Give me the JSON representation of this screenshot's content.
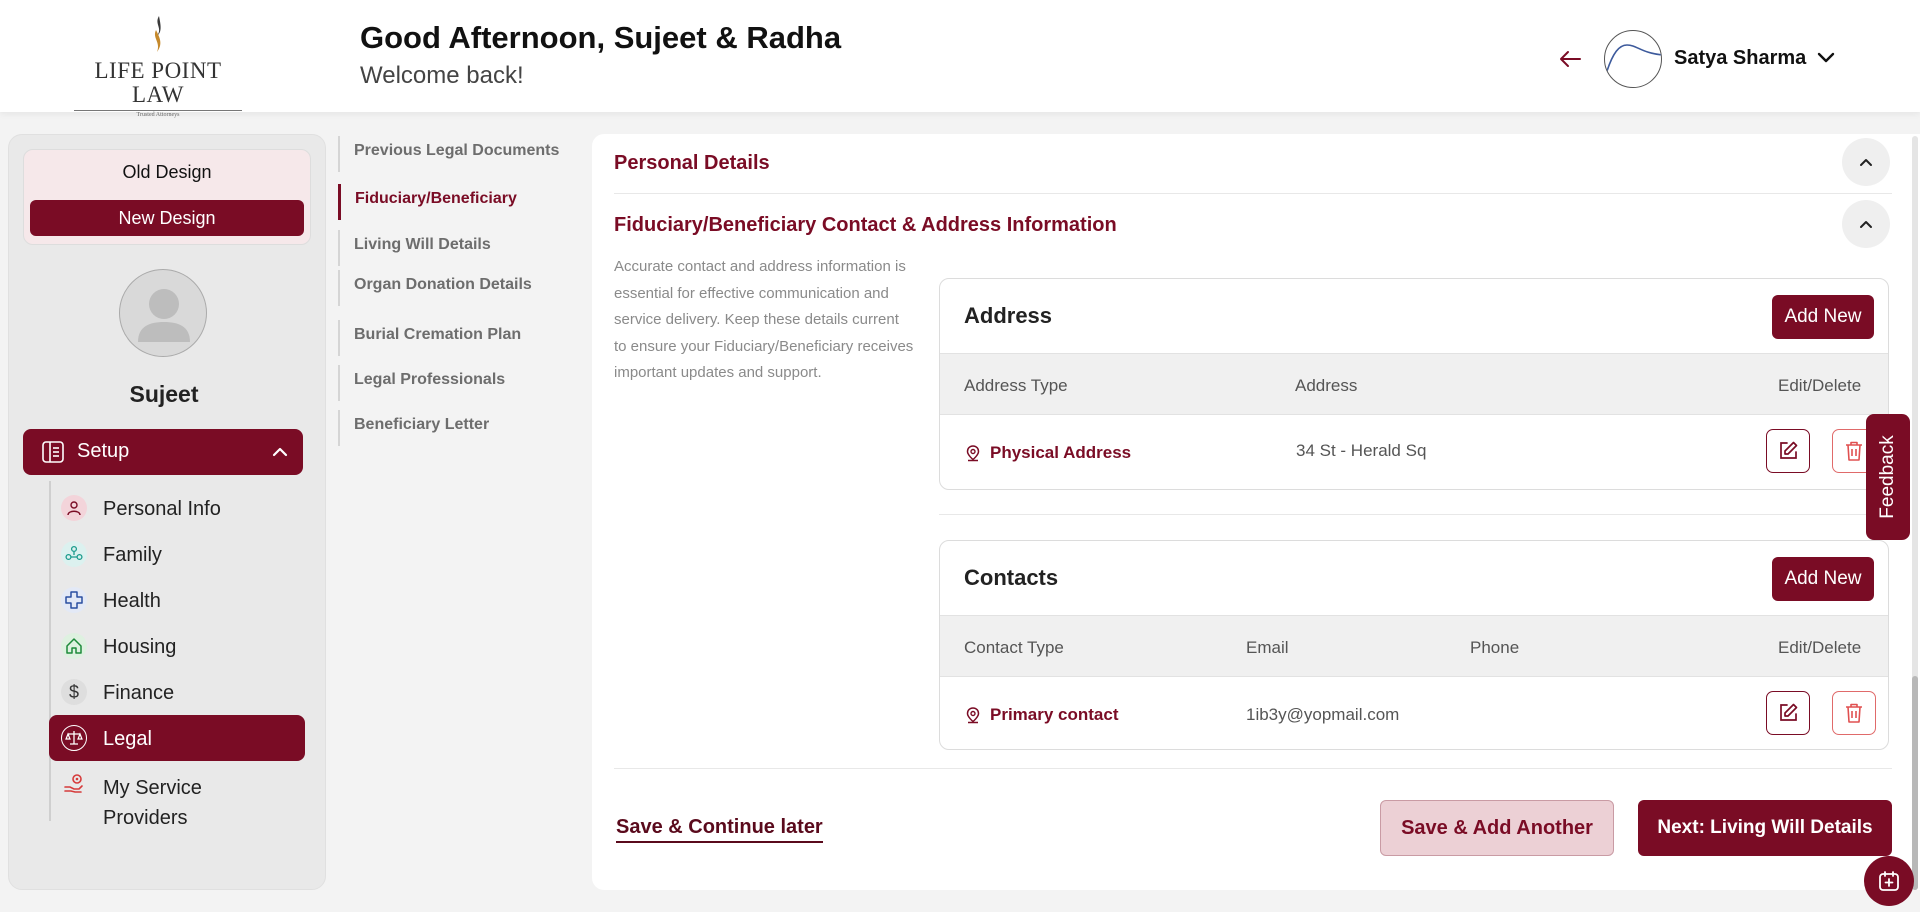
{
  "brand": {
    "logo_text": "LIFE POINT LAW",
    "logo_tagline": "Trusted Attorneys"
  },
  "header": {
    "greeting": "Good Afternoon, Sujeet & Radha",
    "welcome": "Welcome back!",
    "user_name": "Satya Sharma"
  },
  "sidebar": {
    "old_design": "Old Design",
    "new_design": "New Design",
    "profile_name": "Sujeet",
    "setup_label": "Setup",
    "items": [
      {
        "label": "Personal Info",
        "icon": "person-icon"
      },
      {
        "label": "Family",
        "icon": "family-icon"
      },
      {
        "label": "Health",
        "icon": "health-cross-icon"
      },
      {
        "label": "Housing",
        "icon": "house-icon"
      },
      {
        "label": "Finance",
        "icon": "dollar-icon"
      },
      {
        "label": "Legal",
        "icon": "scales-icon"
      },
      {
        "label": "My Service Providers",
        "icon": "hand-gear-icon"
      }
    ],
    "active_item": "Legal"
  },
  "subnav": {
    "items": [
      "Previous Legal Documents",
      "Fiduciary/Beneficiary",
      "Living Will Details",
      "Organ Donation Details",
      "Burial Cremation Plan",
      "Legal Professionals",
      "Beneficiary Letter"
    ],
    "active": "Fiduciary/Beneficiary"
  },
  "main": {
    "personal_details_title": "Personal Details",
    "fiduciary_title": "Fiduciary/Beneficiary Contact & Address Information",
    "description": "Accurate contact and address information is essential for effective communication and service delivery. Keep these details current to ensure your Fiduciary/Beneficiary receives important updates and support.",
    "address_card": {
      "title": "Address",
      "add_label": "Add New",
      "columns": [
        "Address Type",
        "Address",
        "Edit/Delete"
      ],
      "rows": [
        {
          "type": "Physical Address",
          "address": "34 St - Herald Sq"
        }
      ]
    },
    "contacts_card": {
      "title": "Contacts",
      "add_label": "Add New",
      "columns": [
        "Contact Type",
        "Email",
        "Phone",
        "Edit/Delete"
      ],
      "rows": [
        {
          "type": "Primary contact",
          "email": "1ib3y@yopmail.com",
          "phone": ""
        }
      ]
    },
    "save_later": "Save & Continue later",
    "save_add": "Save & Add Another",
    "next": "Next: Living Will Details"
  },
  "feedback_label": "Feedback",
  "colors": {
    "brand": "#7a0c25",
    "brand_light": "#ecd0d5",
    "background": "#f3f3f3"
  }
}
